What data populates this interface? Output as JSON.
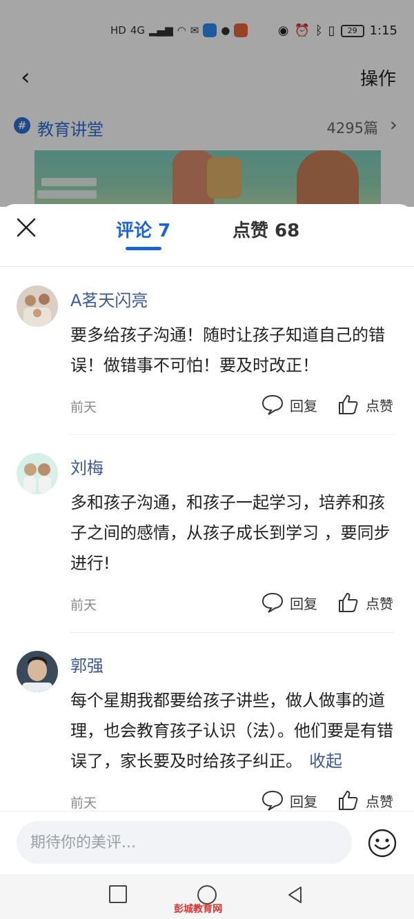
{
  "status_bar": {
    "network_label": "HD",
    "network_type": "4G",
    "battery_level": "29",
    "time": "1:15"
  },
  "nav": {
    "action_label": "操作"
  },
  "topic": {
    "name": "教育讲堂",
    "count": "4295篇",
    "icon_glyph": "#"
  },
  "tabs": {
    "comments_label": "评论 7",
    "likes_label": "点赞 68"
  },
  "comments": [
    {
      "user": "A茗天闪亮",
      "text": "要多给孩子沟通！随时让孩子知道自己的错误！做错事不可怕！要及时改正！",
      "time": "前天",
      "reply_label": "回复",
      "like_label": "点赞"
    },
    {
      "user": "刘梅",
      "text": "多和孩子沟通，和孩子一起学习，培养和孩子之间的感情，从孩子成长到学习 ，要同步进行!",
      "time": "前天",
      "reply_label": "回复",
      "like_label": "点赞"
    },
    {
      "user": "郭强",
      "text": "每个星期我都要给孩子讲些，做人做事的道理，也会教育孩子认识（法）。他们要是有错误了，家长要及时给孩子纠正。",
      "collapse_label": "收起",
      "time": "前天",
      "reply_label": "回复",
      "like_label": "点赞"
    }
  ],
  "input": {
    "placeholder": "期待你的美评..."
  },
  "watermark": "彭城教育网",
  "colors": {
    "accent": "#1e63d6",
    "username": "#3e5a93",
    "muted": "#888888"
  }
}
